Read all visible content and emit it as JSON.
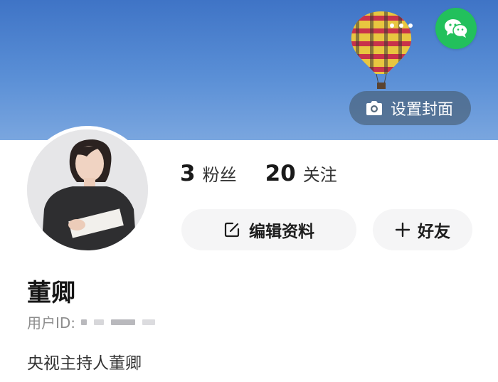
{
  "header": {
    "set_cover_label": "设置封面",
    "icons": {
      "wechat": "wechat-icon",
      "more": "more-dots-icon",
      "camera": "camera-icon"
    }
  },
  "profile": {
    "name": "董卿",
    "user_id_label": "用户ID:",
    "bio": "央视主持人董卿"
  },
  "stats": [
    {
      "count": "3",
      "label": "粉丝"
    },
    {
      "count": "20",
      "label": "关注"
    }
  ],
  "actions": {
    "edit_label": "编辑资料",
    "add_friend_label": "好友"
  },
  "colors": {
    "cover_blue": "#4a7fcd",
    "wechat_green": "#22c05c",
    "button_bg": "#f5f5f6"
  }
}
